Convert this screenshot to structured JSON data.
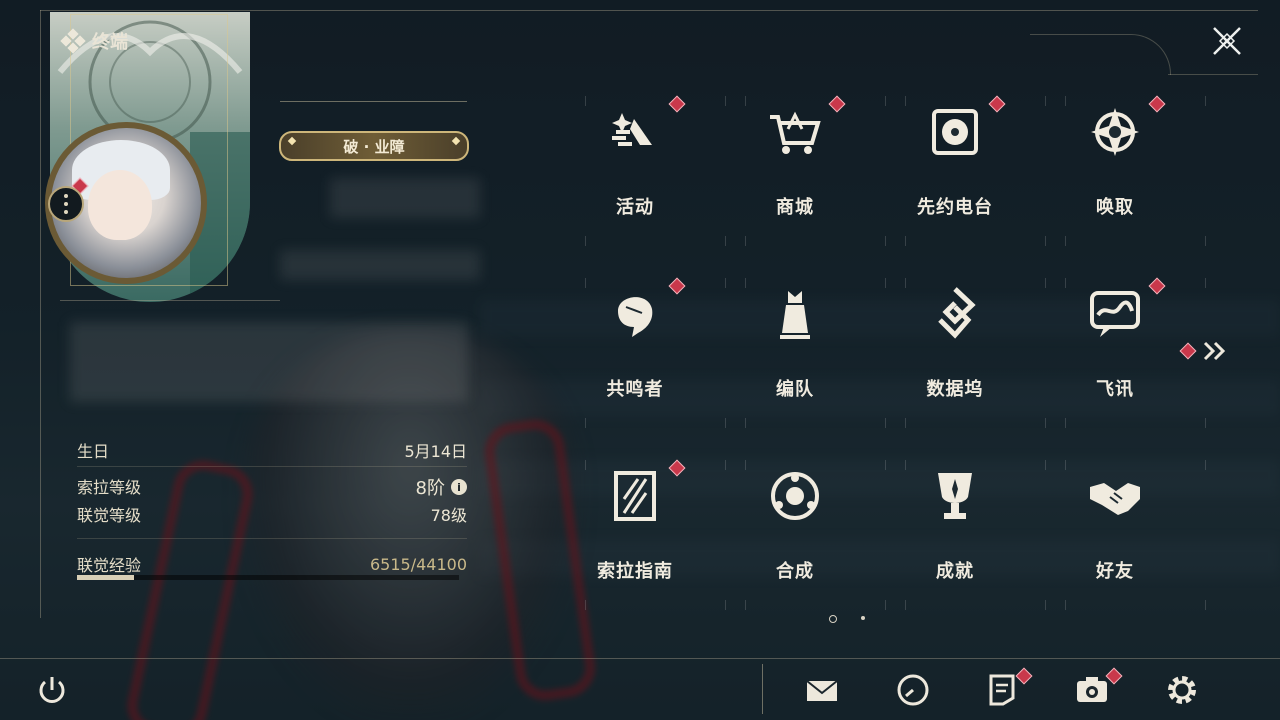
{
  "header": {
    "title": "终端"
  },
  "profile": {
    "title_badge": "破 · 业障",
    "birthday_label": "生日",
    "birthday_value": "5月14日",
    "sola_level_label": "索拉等级",
    "sola_level_value": "8阶",
    "union_level_label": "联觉等级",
    "union_level_value": "78级",
    "union_exp_label": "联觉经验",
    "union_exp_value": "6515/44100",
    "union_exp_progress": 0.148
  },
  "menu": {
    "items": [
      {
        "label": "活动",
        "icon": "sparkle-icon",
        "badge": true
      },
      {
        "label": "商城",
        "icon": "cart-icon",
        "badge": true
      },
      {
        "label": "先约电台",
        "icon": "radio-icon",
        "badge": true
      },
      {
        "label": "唤取",
        "icon": "convene-icon",
        "badge": true
      },
      {
        "label": "共鸣者",
        "icon": "resonator-icon",
        "badge": true
      },
      {
        "label": "编队",
        "icon": "team-icon",
        "badge": false
      },
      {
        "label": "数据坞",
        "icon": "data-bank-icon",
        "badge": false
      },
      {
        "label": "飞讯",
        "icon": "message-icon",
        "badge": true
      },
      {
        "label": "索拉指南",
        "icon": "guidebook-icon",
        "badge": true
      },
      {
        "label": "合成",
        "icon": "synthesis-icon",
        "badge": false
      },
      {
        "label": "成就",
        "icon": "trophy-icon",
        "badge": false
      },
      {
        "label": "好友",
        "icon": "friends-icon",
        "badge": false
      }
    ]
  },
  "pagination": {
    "current": 1,
    "total": 2
  },
  "bottom_bar": [
    "power-icon",
    "mail-icon",
    "clock-icon",
    "notes-icon",
    "camera-icon",
    "settings-icon"
  ],
  "colors": {
    "accent": "#c9384b",
    "gold": "#cdb67a",
    "text": "#f0ebdf"
  }
}
